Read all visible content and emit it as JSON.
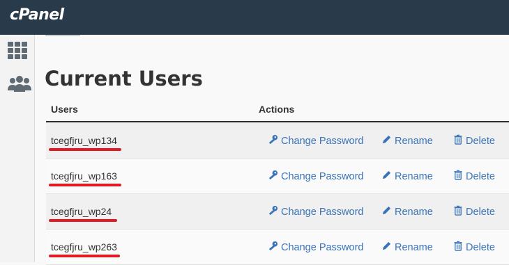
{
  "app": {
    "logo": "cPanel"
  },
  "page": {
    "title": "Current Users"
  },
  "table": {
    "headers": {
      "users": "Users",
      "actions": "Actions"
    },
    "rows": [
      {
        "username": "tcegfjru_wp134",
        "underline_highlight": true
      },
      {
        "username": "tcegfjru_wp163",
        "underline_highlight": true
      },
      {
        "username": "tcegfjru_wp24",
        "underline_highlight": true
      },
      {
        "username": "tcegfjru_wp263",
        "underline_highlight": true
      }
    ],
    "actions": {
      "change_password": "Change Password",
      "rename": "Rename",
      "delete": "Delete"
    }
  },
  "sidebar": {
    "icons": [
      "grid-icon",
      "users-icon"
    ]
  },
  "colors": {
    "topbar": "#293a4a",
    "link": "#3a73b8",
    "highlight": "#e01b24"
  }
}
